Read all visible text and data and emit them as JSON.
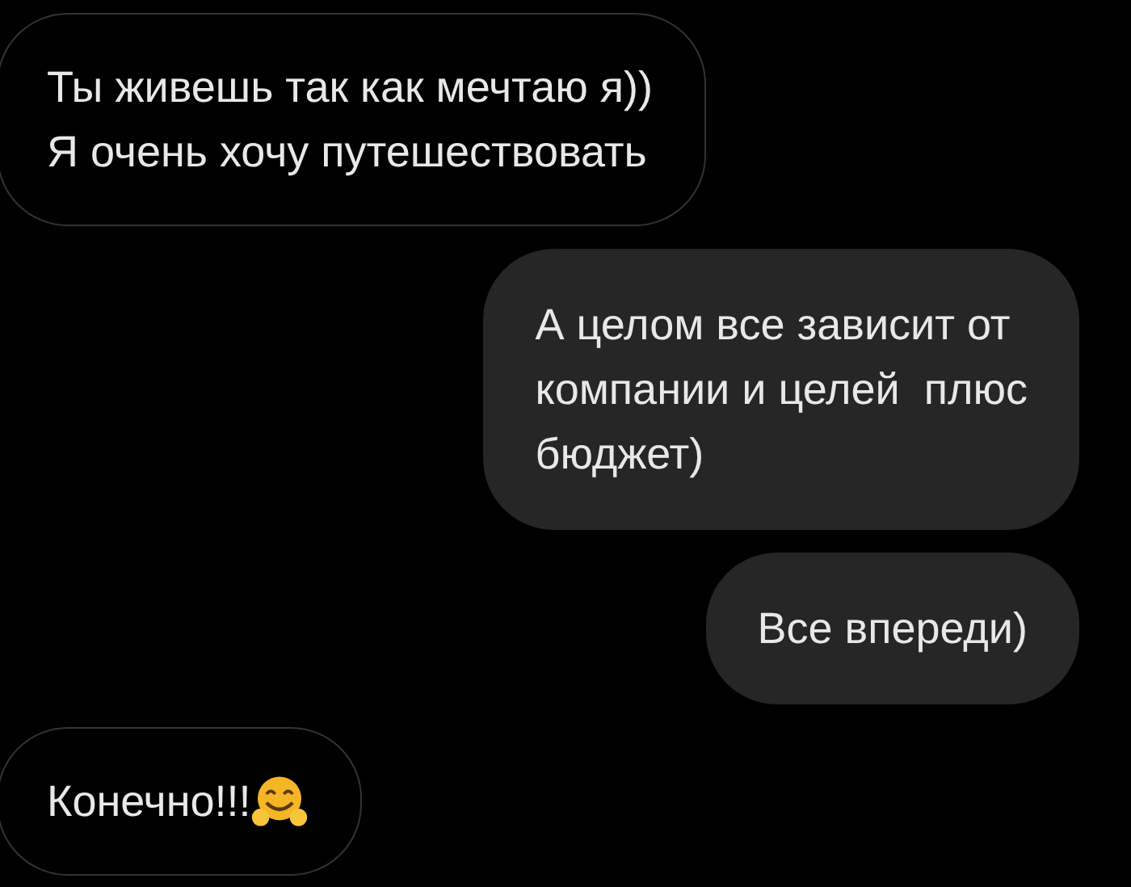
{
  "messages": [
    {
      "kind": "incoming",
      "lines": [
        "Ты живешь так как мечтаю я))",
        "Я очень хочу путешествовать"
      ],
      "icon": false
    },
    {
      "kind": "outgoing",
      "lines": [
        "А целом все зависит от",
        "компании и целей  плюс",
        "бюджет)"
      ],
      "icon": false
    },
    {
      "kind": "outgoing",
      "lines": [
        "Все впереди)"
      ],
      "icon": false
    },
    {
      "kind": "incoming",
      "lines": [
        "Конечно!!!"
      ],
      "icon": true
    }
  ]
}
